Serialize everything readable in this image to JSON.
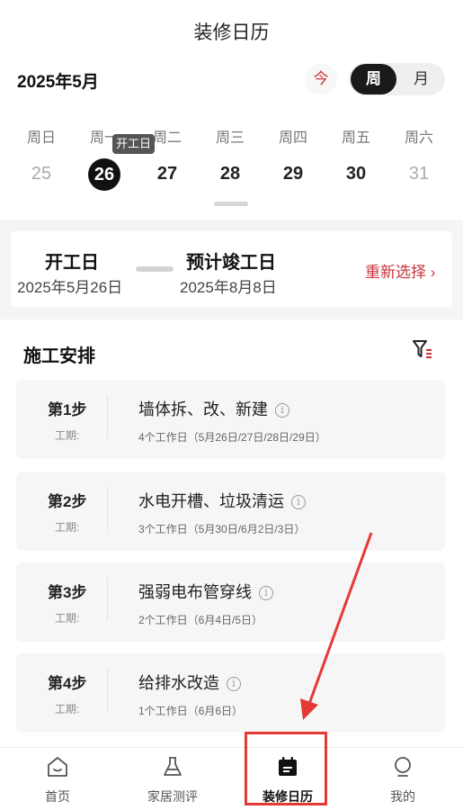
{
  "header": {
    "title": "装修日历"
  },
  "calendar": {
    "month_label": "2025年5月",
    "today_label": "今",
    "view_week": "周",
    "view_month": "月",
    "weekdays": [
      "周日",
      "周一",
      "周二",
      "周三",
      "周四",
      "周五",
      "周六"
    ],
    "dates": [
      "25",
      "26",
      "27",
      "28",
      "29",
      "30",
      "31"
    ],
    "selected_badge": "开工日"
  },
  "schedule_card": {
    "start_label": "开工日",
    "start_date": "2025年5月26日",
    "end_label": "预计竣工日",
    "end_date": "2025年8月8日",
    "reselect": "重新选择 ›"
  },
  "construction": {
    "title": "施工安排",
    "filter_icon": "filter-icon",
    "steps": [
      {
        "num": "第1步",
        "period_label": "工期:",
        "name": "墙体拆、改、新建",
        "days": "4个工作日（5月26日/27日/28日/29日）"
      },
      {
        "num": "第2步",
        "period_label": "工期:",
        "name": "水电开槽、垃圾清运",
        "days": "3个工作日（5月30日/6月2日/3日）"
      },
      {
        "num": "第3步",
        "period_label": "工期:",
        "name": "强弱电布管穿线",
        "days": "2个工作日（6月4日/5日）"
      },
      {
        "num": "第4步",
        "period_label": "工期:",
        "name": "给排水改造",
        "days": "1个工作日（6月6日）"
      }
    ]
  },
  "tabbar": {
    "items": [
      {
        "label": "首页",
        "icon": "home-icon"
      },
      {
        "label": "家居测评",
        "icon": "flask-icon"
      },
      {
        "label": "装修日历",
        "icon": "calendar-icon"
      },
      {
        "label": "我的",
        "icon": "profile-icon"
      }
    ]
  },
  "colors": {
    "accent": "#c8323a",
    "annotation": "#e53935",
    "selected": "#111111"
  }
}
